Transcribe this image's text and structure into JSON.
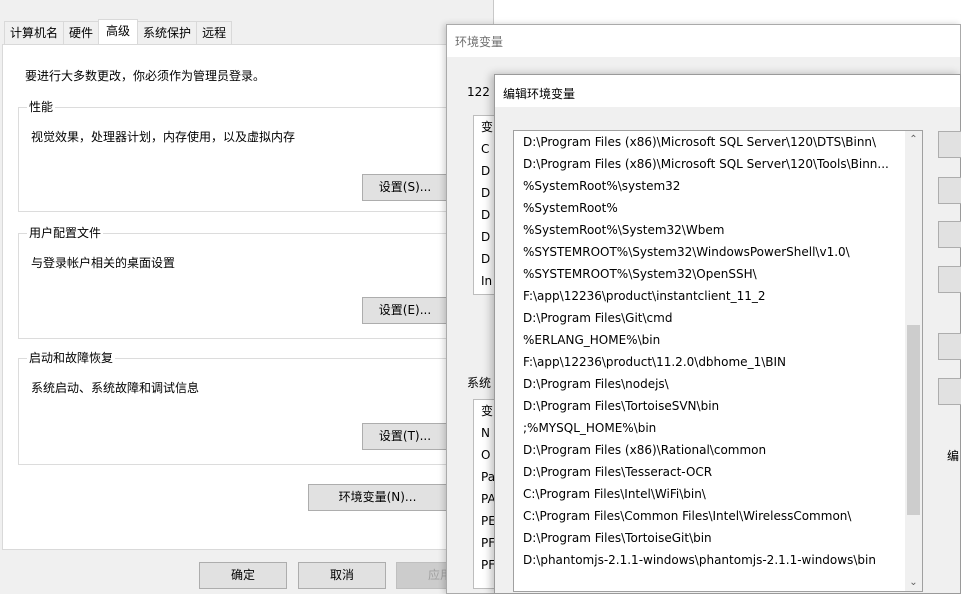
{
  "sysprops": {
    "tabs": [
      "计算机名",
      "硬件",
      "高级",
      "系统保护",
      "远程"
    ],
    "active_tab": "高级",
    "admin_note": "要进行大多数更改，你必须作为管理员登录。",
    "groups": [
      {
        "title": "性能",
        "desc": "视觉效果，处理器计划，内存使用，以及虚拟内存",
        "button": "设置(S)..."
      },
      {
        "title": "用户配置文件",
        "desc": "与登录帐户相关的桌面设置",
        "button": "设置(E)..."
      },
      {
        "title": "启动和故障恢复",
        "desc": "系统启动、系统故障和调试信息",
        "button": "设置(T)..."
      }
    ],
    "env_button": "环境变量(N)...",
    "ok": "确定",
    "cancel": "取消",
    "apply": "应用"
  },
  "envvars": {
    "title": "环境变量",
    "user_section": "122",
    "user_list": [
      "变",
      "C",
      "D",
      "D",
      "D",
      "D",
      "D",
      "In"
    ],
    "system_section": "系统",
    "system_list": [
      "变",
      "N",
      "O",
      "Pa",
      "PA",
      "PE",
      "PF",
      "PF"
    ]
  },
  "editvar": {
    "title": "编辑环境变量",
    "paths": [
      "D:\\Program Files (x86)\\Microsoft SQL Server\\120\\DTS\\Binn\\",
      "D:\\Program Files (x86)\\Microsoft SQL Server\\120\\Tools\\Binn...",
      "%SystemRoot%\\system32",
      "%SystemRoot%",
      "%SystemRoot%\\System32\\Wbem",
      "%SYSTEMROOT%\\System32\\WindowsPowerShell\\v1.0\\",
      "%SYSTEMROOT%\\System32\\OpenSSH\\",
      "F:\\app\\12236\\product\\instantclient_11_2",
      "D:\\Program Files\\Git\\cmd",
      "%ERLANG_HOME%\\bin",
      "F:\\app\\12236\\product\\11.2.0\\dbhome_1\\BIN",
      "D:\\Program Files\\nodejs\\",
      "D:\\Program Files\\TortoiseSVN\\bin",
      ";%MYSQL_HOME%\\bin",
      "D:\\Program Files (x86)\\Rational\\common",
      "D:\\Program Files\\Tesseract-OCR",
      "C:\\Program Files\\Intel\\WiFi\\bin\\",
      "C:\\Program Files\\Common Files\\Intel\\WirelessCommon\\",
      "D:\\Program Files\\TortoiseGit\\bin",
      "D:\\phantomjs-2.1.1-windows\\phantomjs-2.1.1-windows\\bin"
    ],
    "side_label": "编",
    "scroll": {
      "up": "chevron-up-icon",
      "down": "chevron-down-icon",
      "position": 0.75
    }
  }
}
